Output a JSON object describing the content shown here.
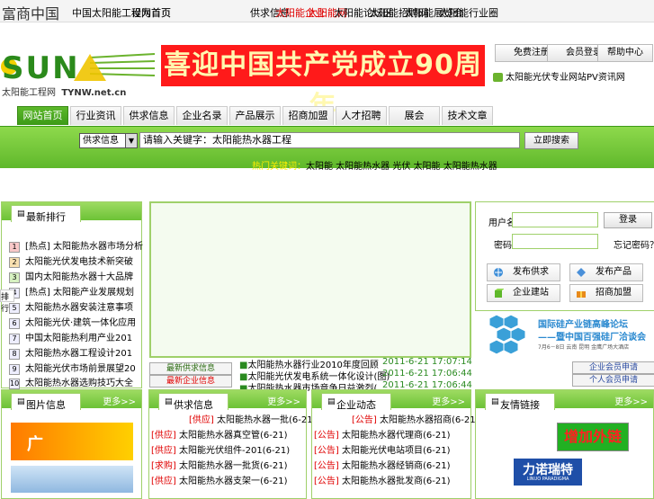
{
  "topbar": {
    "logo_text": "富商中国",
    "left_links": [
      "中国太阳能工程网首页",
      "设为首页"
    ],
    "links": [
      "供求信息",
      "太阳能企业",
      "太阳能网",
      "太阳能论坛区",
      "太阳能招聘网",
      "太阳能展览会",
      "太阳能行业圈"
    ]
  },
  "logo": {
    "mark": "SUN",
    "subtitle": "太阳能工程网",
    "domain": "TYNW.net.cn"
  },
  "banner": {
    "text": "喜迎中国共产党成立90周年"
  },
  "top_buttons": [
    "免费注册",
    "会员登录",
    "帮助中心"
  ],
  "pv_text": "太阳能光伏专业网站PV资讯网",
  "nav": {
    "tabs": [
      "网站首页",
      "行业资讯",
      "供求信息",
      "企业名录",
      "产品展示",
      "招商加盟",
      "人才招聘",
      "展会",
      "技术文章"
    ],
    "active_index": 0
  },
  "search": {
    "select_value": "供求信息",
    "input_value": "请输入关键字：太阳能热水器工程",
    "button_label": "立即搜索",
    "hot_label": "热门关键词：",
    "hot_words": "太阳能 太阳能热水器 光伏 太阳能 太阳能热水器"
  },
  "left_panel": {
    "title": "最新排行",
    "items": [
      {
        "num": "1",
        "text": "[热点] 太阳能热水器市场分析"
      },
      {
        "num": "2",
        "text": "太阳能光伏发电技术新突破"
      },
      {
        "num": "3",
        "text": "国内太阳能热水器十大品牌"
      },
      {
        "num": "4",
        "text": "[热点] 太阳能产业发展规划"
      },
      {
        "num": "5",
        "text": "太阳能热水器安装注意事项"
      },
      {
        "num": "6",
        "text": "太阳能光伏·建筑一体化应用"
      },
      {
        "num": "7",
        "text": "中国太阳能热利用产业201"
      },
      {
        "num": "8",
        "text": "太阳能热水器工程设计201"
      },
      {
        "num": "9",
        "text": "太阳能光伏市场前景展望20"
      },
      {
        "num": "10",
        "text": "太阳能热水器选购技巧大全"
      }
    ],
    "side_tag": "排行"
  },
  "center": {
    "btn_left_1": "最新供求信息",
    "btn_left_2": "最新企业信息",
    "news": [
      {
        "text": "太阳能热水器行业2010年度回顾",
        "date": "2011-6-21 17:07:14"
      },
      {
        "text": "太阳能光伏发电系统一体化设计(图)",
        "date": "2011-6-21 17:06:44"
      },
      {
        "text": "太阳能热水器市场竞争日益激烈(",
        "date": "2011-6-21 17:06:44"
      }
    ]
  },
  "login": {
    "user_label": "用户名：",
    "pass_label": "密码：",
    "login_btn": "登录",
    "forgot": "忘记密码？",
    "buttons": [
      "发布供求",
      "发布产品",
      "企业建站",
      "招商加盟"
    ]
  },
  "forum_ad": {
    "line1": "国际硅产业链高峰论坛",
    "line2": "——暨中国百强硅厂洽谈会",
    "line3": "7月6－8日 云南 昆明 金鹰广场大酒店"
  },
  "right_small_btns": [
    "企业会员申请",
    "个人会员申请"
  ],
  "bottom_panels": [
    {
      "title": "图片信息",
      "more": "更多>>"
    },
    {
      "title": "供求信息",
      "more": "更多>>",
      "items": [
        "[供应] 太阳能热水器一批(6-21)",
        "[供应] 太阳能热水器真空管(6-21)",
        "[供应] 太阳能光伏组件-201(6-21)",
        "[求购] 太阳能热水器一批货(6-21)",
        "[供应] 太阳能热水器支架一(6-21)"
      ]
    },
    {
      "title": "企业动态",
      "more": "更多>>",
      "items": [
        "[公告] 太阳能热水器招商(6-21)",
        "[公告] 太阳能热水器代理商(6-21)",
        "[公告] 太阳能光伏电站项目(6-21)",
        "[公告] 太阳能热水器经销商(6-21)",
        "[公告] 太阳能热水器批发商(6-21)"
      ]
    },
    {
      "title": "友情链接",
      "more": "更多>>",
      "link1": "增加外链",
      "link2": "力诺瑞特",
      "link2_sub": "LINUO PARADIGMA"
    }
  ],
  "colors": {
    "green": "#5fb82b",
    "red": "#e00000",
    "banner_red": "#ff1a1a"
  }
}
